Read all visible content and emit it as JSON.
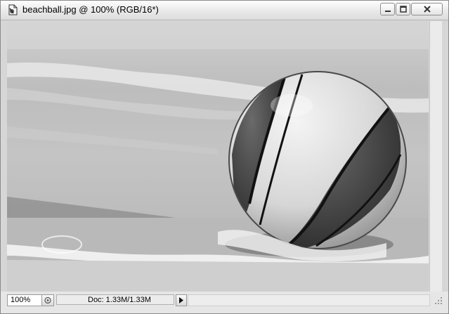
{
  "window": {
    "title": "beachball.jpg @ 100% (RGB/16*)",
    "icon": "photoshop-document-icon"
  },
  "controls": {
    "minimize_icon": "minimize-icon",
    "maximize_icon": "maximize-icon",
    "close_icon": "close-icon"
  },
  "canvas": {
    "image_subject": "beachball on shoreline",
    "color_mode": "grayscale"
  },
  "status": {
    "zoom": "100%",
    "doc_info": "Doc: 1.33M/1.33M",
    "menu_arrow_icon": "triangle-right-icon"
  }
}
